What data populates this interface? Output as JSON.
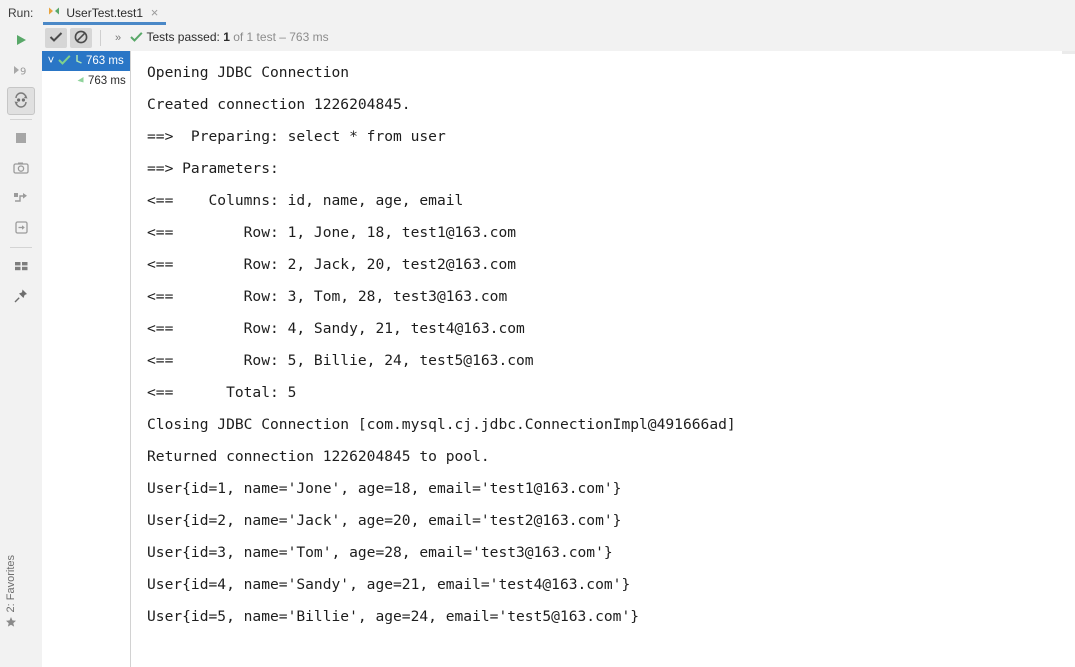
{
  "window": {
    "tool_window_label": "Run:",
    "bottom_tool_window": "2: Favorites"
  },
  "tabs": [
    {
      "label": "UserTest.test1",
      "close_label": "×",
      "selected": true,
      "icon": "junit-run-config-icon"
    }
  ],
  "left_toolbar": {
    "items": [
      {
        "name": "rerun-button",
        "title": "Rerun",
        "icon": "play-icon"
      },
      {
        "name": "rerun-failed-tests-button",
        "title": "Rerun Failed Tests",
        "icon": "rerun-failed-icon"
      },
      {
        "name": "toggle-auto-test-button",
        "title": "Toggle auto-test",
        "icon": "auto-test-icon",
        "pressed": true
      },
      {
        "name": "stop-button",
        "title": "Stop",
        "icon": "stop-icon"
      },
      {
        "name": "dump-threads-button",
        "title": "Dump Threads",
        "icon": "camera-icon"
      },
      {
        "name": "restore-layout-button",
        "title": "Restore Layout",
        "icon": "restore-layout-icon"
      },
      {
        "name": "export-test-results-button",
        "title": "Export Test Results",
        "icon": "export-icon"
      },
      {
        "name": "layout-settings-button",
        "title": "Layout Settings",
        "icon": "grid-icon"
      },
      {
        "name": "pin-tab-button",
        "title": "Pin Tab",
        "icon": "pin-icon"
      }
    ]
  },
  "status_toolbar": {
    "toggles": [
      {
        "name": "show-passed-toggle",
        "icon": "check-icon",
        "pressed": true
      },
      {
        "name": "hide-ignored-toggle",
        "icon": "no-entry-icon",
        "pressed": true
      }
    ],
    "overflow_label": "»",
    "status": {
      "icon": "check-icon",
      "prefix": "Tests passed: ",
      "count": "1",
      "suffix": " of 1 test – 763 ms"
    }
  },
  "test_tree": {
    "rows": [
      {
        "name": "test-tree-root-row",
        "selected": true,
        "twisty": "˅",
        "status_icon": "green-check-icon",
        "time_icon": "clock-icon",
        "label": "763 ms",
        "indent": 0
      },
      {
        "name": "test-tree-child-row",
        "selected": false,
        "twisty": "",
        "status_icon": "",
        "time_icon": "leaf-icon",
        "label": "763 ms",
        "indent": 18
      }
    ]
  },
  "console": {
    "lines": [
      "Opening JDBC Connection",
      "Created connection 1226204845.",
      "==>  Preparing: select * from user",
      "==> Parameters: ",
      "<==    Columns: id, name, age, email",
      "<==        Row: 1, Jone, 18, test1@163.com",
      "<==        Row: 2, Jack, 20, test2@163.com",
      "<==        Row: 3, Tom, 28, test3@163.com",
      "<==        Row: 4, Sandy, 21, test4@163.com",
      "<==        Row: 5, Billie, 24, test5@163.com",
      "<==      Total: 5",
      "Closing JDBC Connection [com.mysql.cj.jdbc.ConnectionImpl@491666ad]",
      "Returned connection 1226204845 to pool.",
      "User{id=1, name='Jone', age=18, email='test1@163.com'}",
      "User{id=2, name='Jack', age=20, email='test2@163.com'}",
      "User{id=3, name='Tom', age=28, email='test3@163.com'}",
      "User{id=4, name='Sandy', age=21, email='test4@163.com'}",
      "User{id=5, name='Billie', age=24, email='test5@163.com'}"
    ]
  },
  "colors": {
    "selection_blue": "#2a76c6",
    "tab_underline": "#4a88c7",
    "success_green": "#59a869",
    "panel_bg": "#f2f2f2",
    "console_bg": "#ffffff",
    "text": "#2b2b2b",
    "dim_text": "#8c8c8c"
  }
}
